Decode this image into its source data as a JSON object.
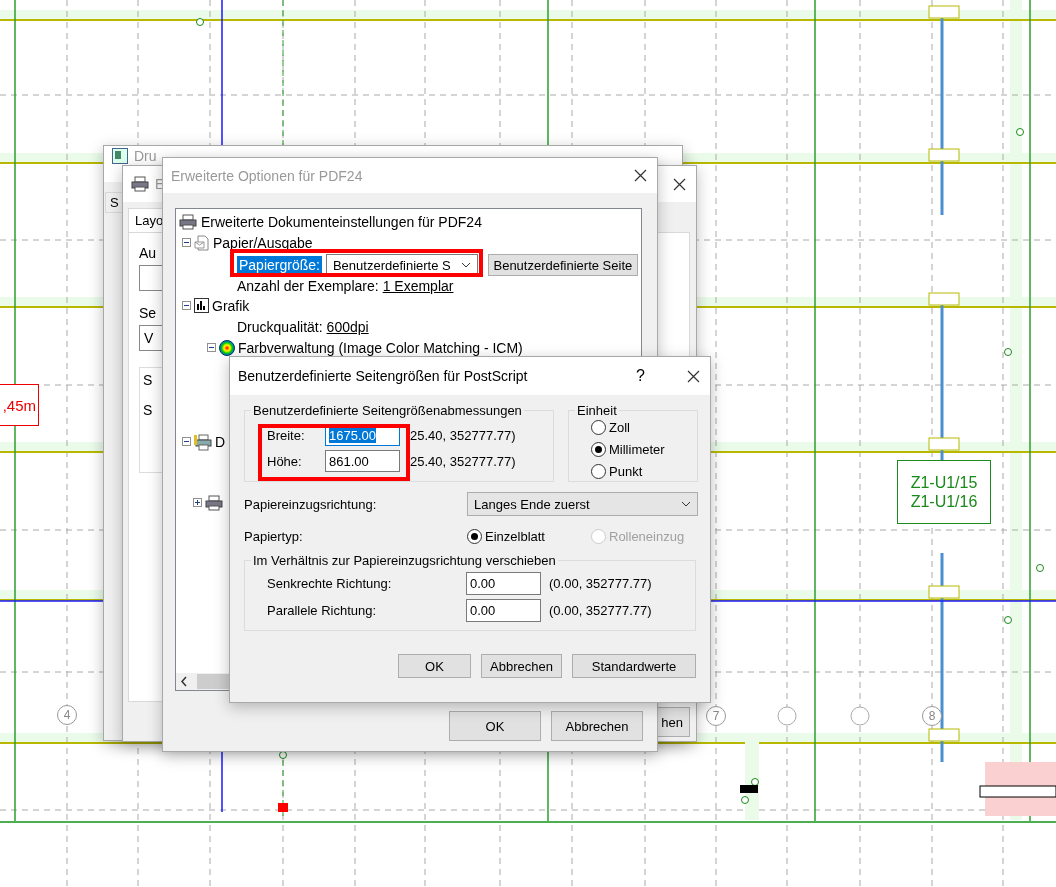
{
  "drawing": {
    "dimension_label": ",45m",
    "tag_lines": [
      "Z1-U1/15",
      "Z1-U1/16"
    ],
    "axis_markers": [
      "4",
      "7",
      "8"
    ]
  },
  "back_windows": [
    {
      "title": "Dru",
      "tab": "S"
    },
    {
      "title": "E",
      "tab": "Layo",
      "labels": [
        "Au",
        "Se"
      ],
      "select_value": "V",
      "group_labels": [
        "S",
        "S"
      ],
      "button": "hen"
    }
  ],
  "options_window": {
    "title": "Erweiterte Optionen für PDF24",
    "tree": {
      "root": "Erweiterte Dokumenteinstellungen für PDF24",
      "items": [
        {
          "label": "Papier/Ausgabe",
          "expanded": true,
          "children": [
            {
              "kind": "select",
              "label": "Papiergröße:",
              "selected": true,
              "value": "Benutzerdefinierte S",
              "button": "Benutzerdefinierte Seite"
            },
            {
              "kind": "link",
              "label": "Anzahl der Exemplare:",
              "value": "1 Exemplar"
            }
          ]
        },
        {
          "label": "Grafik",
          "expanded": true,
          "children": [
            {
              "kind": "link",
              "label": "Druckqualität:",
              "value": "600dpi"
            },
            {
              "kind": "group",
              "label": "Farbverwaltung (Image Color Matching - ICM)",
              "expanded": true
            }
          ]
        },
        {
          "label": "D",
          "expanded": true,
          "children": [
            {
              "kind": "group",
              "expanded": false
            }
          ]
        }
      ]
    },
    "buttons": [
      "OK",
      "Abbrechen"
    ]
  },
  "page_size_dialog": {
    "title": "Benutzerdefinierte Seitengrößen für PostScript",
    "help": "?",
    "dimensions": {
      "legend": "Benutzerdefinierte Seitengrößenabmessungen",
      "fields": [
        {
          "label": "Breite:",
          "value": "1675.00",
          "focused": true,
          "range": "25.40, 352777.77)"
        },
        {
          "label": "Höhe:",
          "value": "861.00",
          "focused": false,
          "range": "25.40, 352777.77)"
        }
      ]
    },
    "unit": {
      "legend": "Einheit",
      "options": [
        {
          "label": "Zoll",
          "selected": false
        },
        {
          "label": "Millimeter",
          "selected": true
        },
        {
          "label": "Punkt",
          "selected": false
        }
      ]
    },
    "feed_direction": {
      "label": "Papiereinzugsrichtung:",
      "value": "Langes Ende zuerst"
    },
    "paper_type": {
      "label": "Papiertyp:",
      "options": [
        {
          "label": "Einzelblatt",
          "selected": true,
          "disabled": false
        },
        {
          "label": "Rolleneinzug",
          "selected": false,
          "disabled": true
        }
      ]
    },
    "offset": {
      "legend": "Im Verhältnis zur Papiereinzugsrichtung verschieben",
      "fields": [
        {
          "label": "Senkrechte Richtung:",
          "value": "0.00",
          "range": "(0.00, 352777.77)"
        },
        {
          "label": "Parallele Richtung:",
          "value": "0.00",
          "range": "(0.00, 352777.77)"
        }
      ]
    },
    "buttons": [
      "OK",
      "Abbrechen",
      "Standardwerte"
    ]
  }
}
